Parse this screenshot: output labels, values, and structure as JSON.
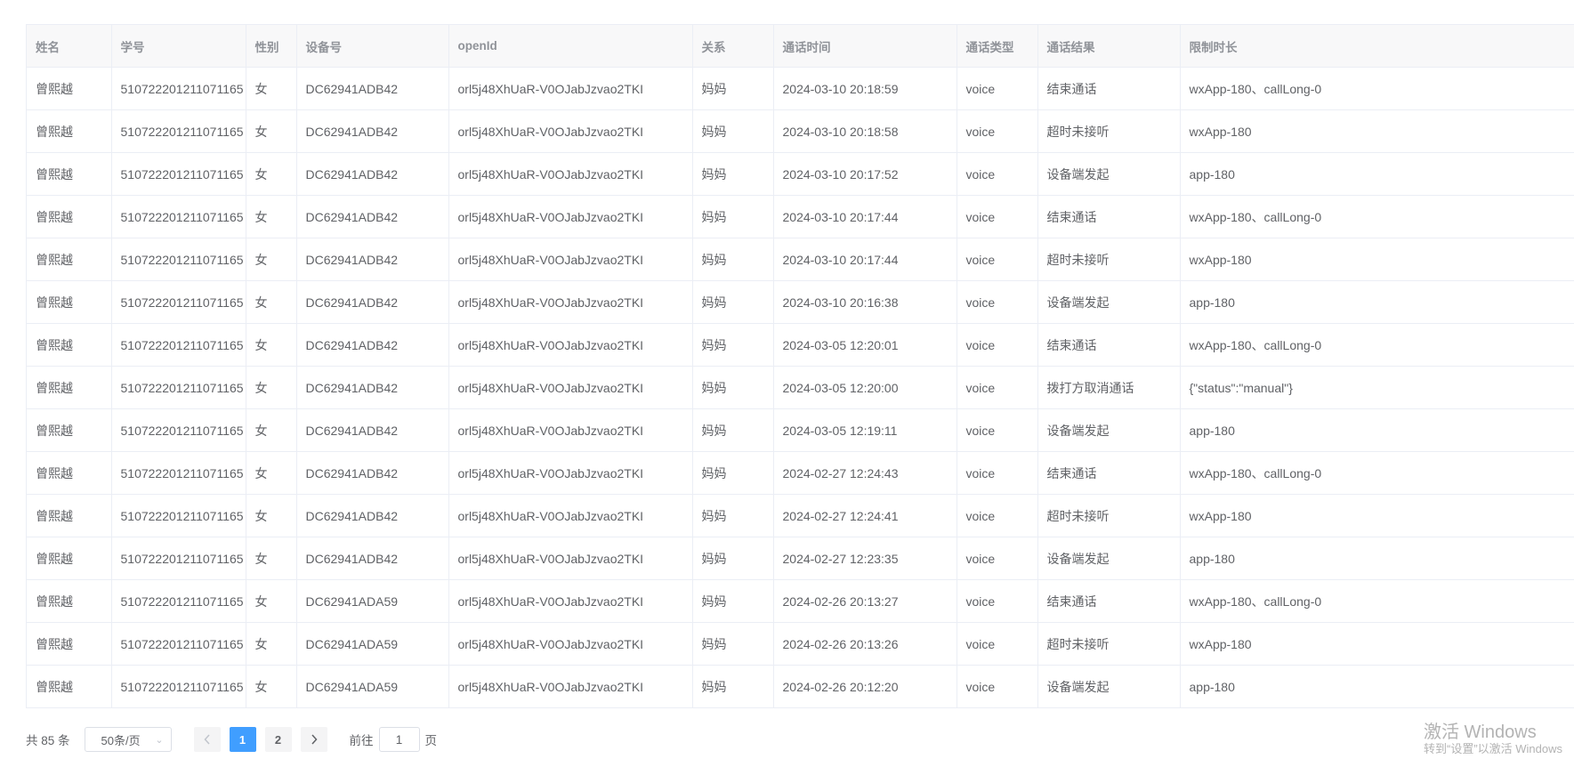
{
  "table": {
    "columns": [
      "姓名",
      "学号",
      "性别",
      "设备号",
      "openId",
      "关系",
      "通话时间",
      "通话类型",
      "通话结果",
      "限制时长"
    ],
    "rows": [
      [
        "曾熙越",
        "510722201211071165",
        "女",
        "DC62941ADB42",
        "orl5j48XhUaR-V0OJabJzvao2TKI",
        "妈妈",
        "2024-03-10 20:18:59",
        "voice",
        "结束通话",
        "wxApp-180、callLong-0"
      ],
      [
        "曾熙越",
        "510722201211071165",
        "女",
        "DC62941ADB42",
        "orl5j48XhUaR-V0OJabJzvao2TKI",
        "妈妈",
        "2024-03-10 20:18:58",
        "voice",
        "超时未接听",
        "wxApp-180"
      ],
      [
        "曾熙越",
        "510722201211071165",
        "女",
        "DC62941ADB42",
        "orl5j48XhUaR-V0OJabJzvao2TKI",
        "妈妈",
        "2024-03-10 20:17:52",
        "voice",
        "设备端发起",
        "app-180"
      ],
      [
        "曾熙越",
        "510722201211071165",
        "女",
        "DC62941ADB42",
        "orl5j48XhUaR-V0OJabJzvao2TKI",
        "妈妈",
        "2024-03-10 20:17:44",
        "voice",
        "结束通话",
        "wxApp-180、callLong-0"
      ],
      [
        "曾熙越",
        "510722201211071165",
        "女",
        "DC62941ADB42",
        "orl5j48XhUaR-V0OJabJzvao2TKI",
        "妈妈",
        "2024-03-10 20:17:44",
        "voice",
        "超时未接听",
        "wxApp-180"
      ],
      [
        "曾熙越",
        "510722201211071165",
        "女",
        "DC62941ADB42",
        "orl5j48XhUaR-V0OJabJzvao2TKI",
        "妈妈",
        "2024-03-10 20:16:38",
        "voice",
        "设备端发起",
        "app-180"
      ],
      [
        "曾熙越",
        "510722201211071165",
        "女",
        "DC62941ADB42",
        "orl5j48XhUaR-V0OJabJzvao2TKI",
        "妈妈",
        "2024-03-05 12:20:01",
        "voice",
        "结束通话",
        "wxApp-180、callLong-0"
      ],
      [
        "曾熙越",
        "510722201211071165",
        "女",
        "DC62941ADB42",
        "orl5j48XhUaR-V0OJabJzvao2TKI",
        "妈妈",
        "2024-03-05 12:20:00",
        "voice",
        "拨打方取消通话",
        "{\"status\":\"manual\"}"
      ],
      [
        "曾熙越",
        "510722201211071165",
        "女",
        "DC62941ADB42",
        "orl5j48XhUaR-V0OJabJzvao2TKI",
        "妈妈",
        "2024-03-05 12:19:11",
        "voice",
        "设备端发起",
        "app-180"
      ],
      [
        "曾熙越",
        "510722201211071165",
        "女",
        "DC62941ADB42",
        "orl5j48XhUaR-V0OJabJzvao2TKI",
        "妈妈",
        "2024-02-27 12:24:43",
        "voice",
        "结束通话",
        "wxApp-180、callLong-0"
      ],
      [
        "曾熙越",
        "510722201211071165",
        "女",
        "DC62941ADB42",
        "orl5j48XhUaR-V0OJabJzvao2TKI",
        "妈妈",
        "2024-02-27 12:24:41",
        "voice",
        "超时未接听",
        "wxApp-180"
      ],
      [
        "曾熙越",
        "510722201211071165",
        "女",
        "DC62941ADB42",
        "orl5j48XhUaR-V0OJabJzvao2TKI",
        "妈妈",
        "2024-02-27 12:23:35",
        "voice",
        "设备端发起",
        "app-180"
      ],
      [
        "曾熙越",
        "510722201211071165",
        "女",
        "DC62941ADA59",
        "orl5j48XhUaR-V0OJabJzvao2TKI",
        "妈妈",
        "2024-02-26 20:13:27",
        "voice",
        "结束通话",
        "wxApp-180、callLong-0"
      ],
      [
        "曾熙越",
        "510722201211071165",
        "女",
        "DC62941ADA59",
        "orl5j48XhUaR-V0OJabJzvao2TKI",
        "妈妈",
        "2024-02-26 20:13:26",
        "voice",
        "超时未接听",
        "wxApp-180"
      ],
      [
        "曾熙越",
        "510722201211071165",
        "女",
        "DC62941ADA59",
        "orl5j48XhUaR-V0OJabJzvao2TKI",
        "妈妈",
        "2024-02-26 20:12:20",
        "voice",
        "设备端发起",
        "app-180"
      ]
    ]
  },
  "pagination": {
    "total_label": "共 85 条",
    "page_size_label": "50条/页",
    "prev_icon": "chevron-left-icon",
    "next_icon": "chevron-right-icon",
    "pages": [
      "1",
      "2"
    ],
    "current_page": "1",
    "goto_prefix": "前往",
    "goto_value": "1",
    "goto_suffix": "页"
  },
  "watermark": {
    "line1": "激活 Windows",
    "line2": "转到“设置”以激活 Windows"
  },
  "colors": {
    "accent": "#409eff",
    "header_bg": "#f8f8f9",
    "border": "#ebeef5"
  }
}
